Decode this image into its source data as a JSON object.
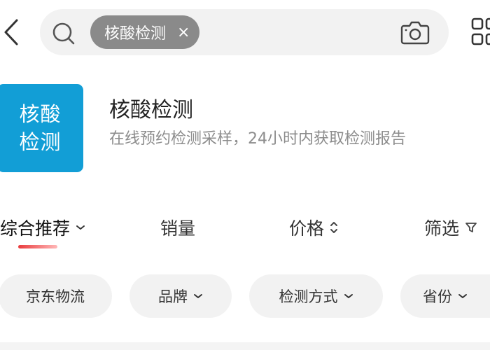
{
  "search": {
    "chip_label": "核酸检测",
    "chip_close": "×"
  },
  "promo": {
    "logo_line1": "核酸",
    "logo_line2": "检测",
    "title": "核酸检测",
    "subtitle": "在线预约检测采样，24小时内获取检测报告"
  },
  "sort_tabs": [
    {
      "label": "综合推荐",
      "active": true
    },
    {
      "label": "销量"
    },
    {
      "label": "价格"
    },
    {
      "label": "筛选"
    }
  ],
  "filters": [
    {
      "label": "京东物流"
    },
    {
      "label": "品牌"
    },
    {
      "label": "检测方式"
    },
    {
      "label": "省份"
    }
  ],
  "colors": {
    "logo_bg": "#129ed6",
    "accent": "#e93b3d",
    "chip_bg": "#8a8a8a"
  }
}
